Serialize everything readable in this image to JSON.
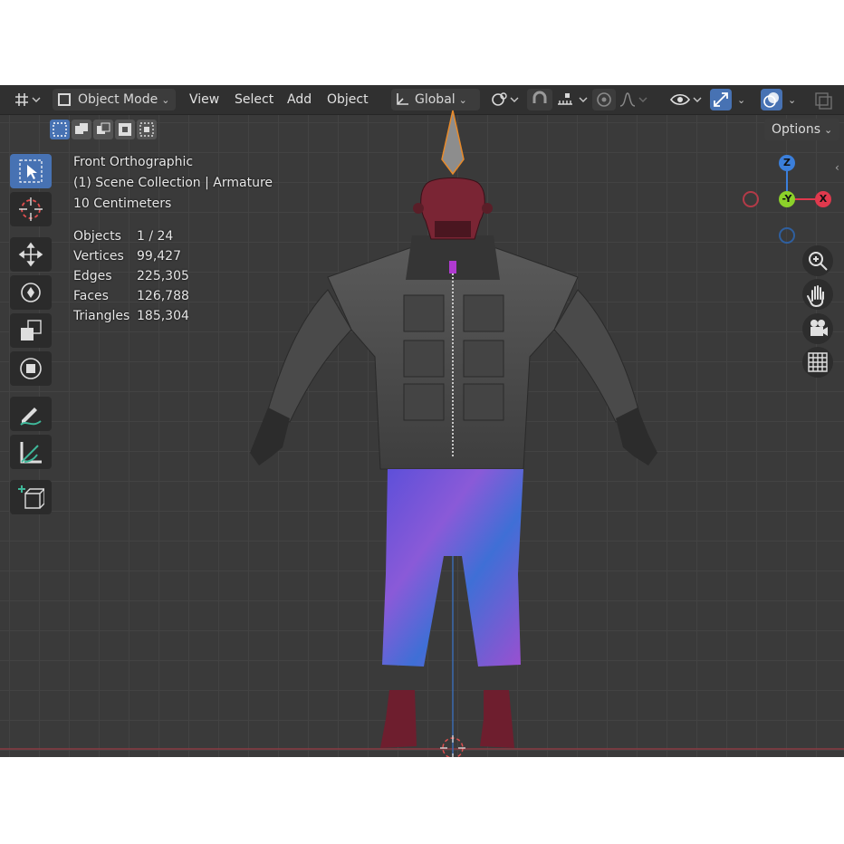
{
  "header": {
    "editor_icon": "editor-type-icon",
    "mode": "Object Mode",
    "menus": [
      "View",
      "Select",
      "Add",
      "Object"
    ],
    "transform_orientation": "Global"
  },
  "options_label": "Options",
  "overlay": {
    "view_name": "Front Orthographic",
    "collection": "(1) Scene Collection | Armature",
    "scale": "10 Centimeters"
  },
  "stats": [
    {
      "label": "Objects",
      "value": "1 / 24"
    },
    {
      "label": "Vertices",
      "value": "99,427"
    },
    {
      "label": "Edges",
      "value": "225,305"
    },
    {
      "label": "Faces",
      "value": "126,788"
    },
    {
      "label": "Triangles",
      "value": "185,304"
    }
  ],
  "gizmo": {
    "z": "Z",
    "y": "-Y",
    "x": "X"
  },
  "colors": {
    "active": "#4772b3",
    "x_axis": "#e0394d",
    "y_axis": "#8cd12a",
    "z_axis": "#3b7fdb"
  }
}
